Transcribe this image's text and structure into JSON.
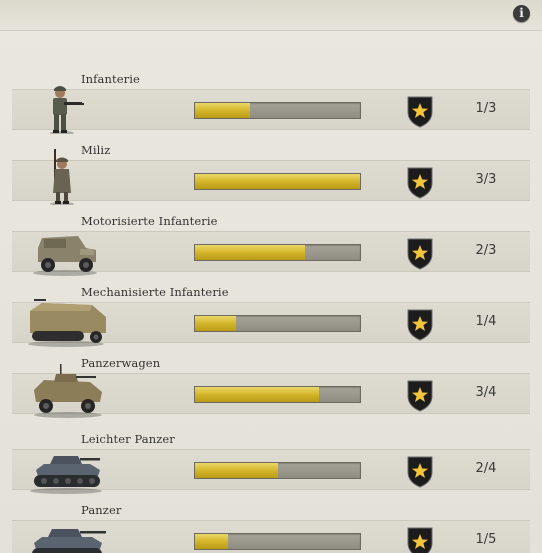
{
  "header": {
    "info_glyph": "i"
  },
  "units": [
    {
      "name": "Infanterie",
      "current": 1,
      "max": 3,
      "count_label": "1/3",
      "icon": "infantry-soldier-icon"
    },
    {
      "name": "Miliz",
      "current": 3,
      "max": 3,
      "count_label": "3/3",
      "icon": "militia-soldier-icon"
    },
    {
      "name": "Motorisierte Infanterie",
      "current": 2,
      "max": 3,
      "count_label": "2/3",
      "icon": "jeep-icon"
    },
    {
      "name": "Mechanisierte Infanterie",
      "current": 1,
      "max": 4,
      "count_label": "1/4",
      "icon": "halftrack-icon"
    },
    {
      "name": "Panzerwagen",
      "current": 3,
      "max": 4,
      "count_label": "3/4",
      "icon": "armored-car-icon"
    },
    {
      "name": "Leichter Panzer",
      "current": 2,
      "max": 4,
      "count_label": "2/4",
      "icon": "light-tank-icon"
    },
    {
      "name": "Panzer",
      "current": 1,
      "max": 5,
      "count_label": "1/5",
      "icon": "tank-icon"
    }
  ],
  "colors": {
    "bar_fill": "#d7b92f",
    "bar_track": "#9a978c",
    "shield": "#1c1c1c",
    "star": "#f2c53a"
  }
}
